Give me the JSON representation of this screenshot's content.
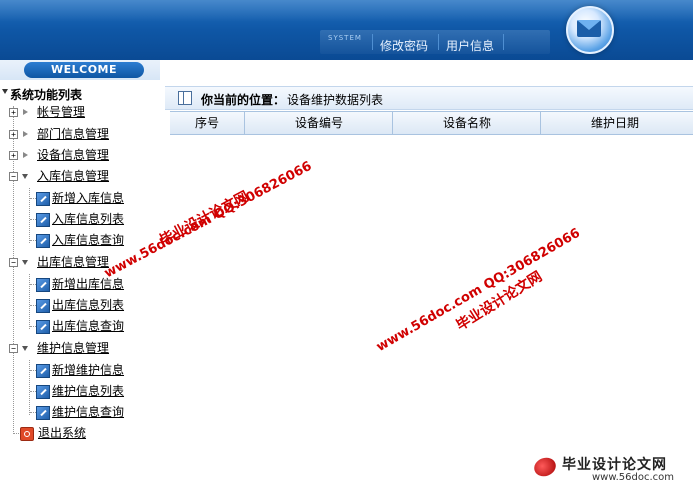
{
  "header": {
    "system_tag": "SYSTEM",
    "nav": [
      "修改密码",
      "用户信息"
    ],
    "icon": "mail-icon"
  },
  "welcome": "WELCOME",
  "sidebar": {
    "title": "系统功能列表",
    "groups": [
      {
        "label": "帐号管理",
        "state": "collapsed",
        "children": []
      },
      {
        "label": "部门信息管理",
        "state": "collapsed",
        "children": []
      },
      {
        "label": "设备信息管理",
        "state": "collapsed",
        "children": []
      },
      {
        "label": "入库信息管理",
        "state": "expanded",
        "children": [
          "新增入库信息",
          "入库信息列表",
          "入库信息查询"
        ]
      },
      {
        "label": "出库信息管理",
        "state": "expanded",
        "children": [
          "新增出库信息",
          "出库信息列表",
          "出库信息查询"
        ]
      },
      {
        "label": "维护信息管理",
        "state": "expanded",
        "children": [
          "新增维护信息",
          "维护信息列表",
          "维护信息查询"
        ]
      }
    ],
    "exit": "退出系统"
  },
  "content": {
    "location_label": "你当前的位置：",
    "location_value": "设备维护数据列表",
    "columns": [
      "序号",
      "设备编号",
      "设备名称",
      "维护日期"
    ]
  },
  "watermarks": [
    {
      "text": "毕业设计论文网"
    },
    {
      "text": "www.56doc.com   QQ:306826066"
    },
    {
      "text": "www.56doc.com   QQ:306826066"
    },
    {
      "text": "毕业设计论文网"
    }
  ],
  "footer_logo": {
    "name": "毕业设计论文网",
    "url": "www.56doc.com"
  },
  "colors": {
    "header_blue": "#0f57a6",
    "watermark_red": "#d00000",
    "table_border": "#a9c3e0"
  }
}
